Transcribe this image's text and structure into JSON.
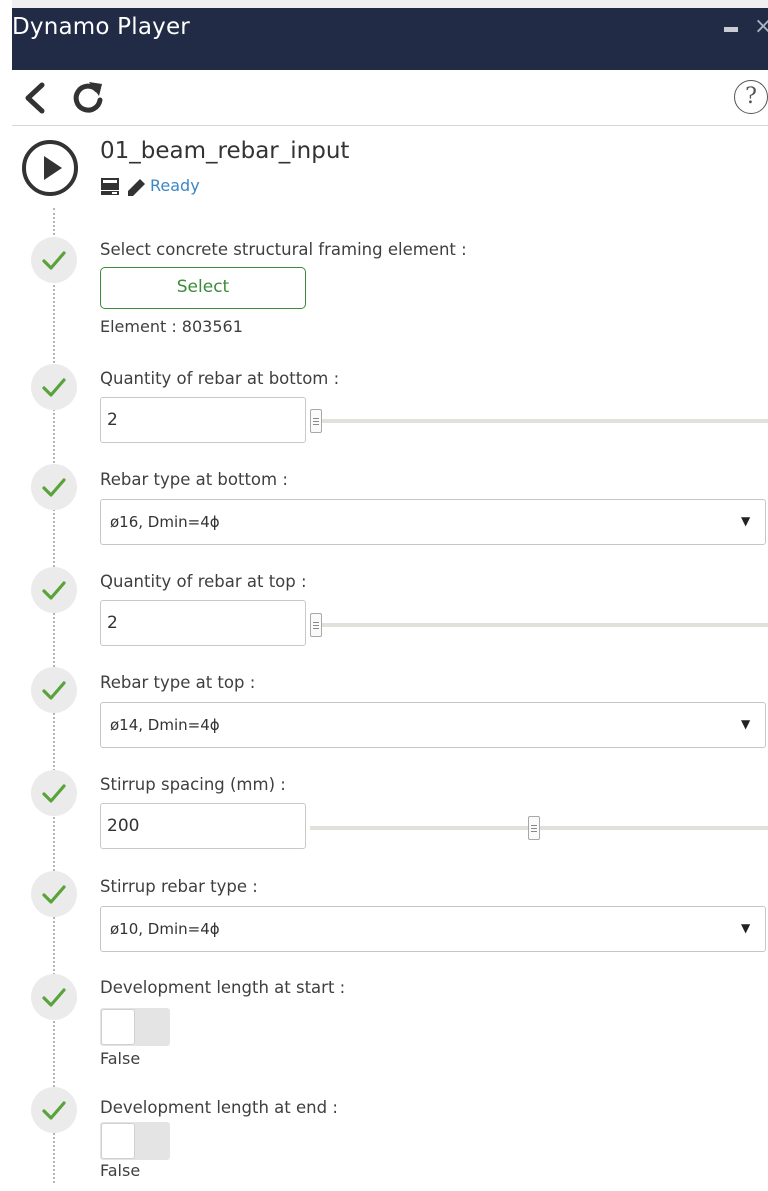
{
  "window": {
    "title": "Dynamo Player",
    "minimize_icon": "minimize-icon",
    "close_glyph": "×"
  },
  "toolbar": {
    "back_icon": "chevron-left-icon",
    "refresh_icon": "refresh-icon",
    "help_glyph": "?"
  },
  "script": {
    "name": "01_beam_rebar_input",
    "status": "Ready",
    "icons": [
      "play-icon",
      "computer-icon",
      "pencil-icon"
    ]
  },
  "colors": {
    "titlebar_bg": "#212b46",
    "check_green": "#59a33a",
    "select_green": "#3a8b3a",
    "status_blue": "#3d86c6"
  },
  "inputs": [
    {
      "label": "Select concrete structural framing element :",
      "type": "select",
      "button": "Select",
      "result": "Element : 803561"
    },
    {
      "label": "Quantity of rebar at bottom :",
      "type": "slider",
      "value": "2",
      "position": 0.0
    },
    {
      "label": "Rebar type at bottom :",
      "type": "dropdown",
      "value": "ø16, Dmin=4ϕ"
    },
    {
      "label": "Quantity of rebar at top :",
      "type": "slider",
      "value": "2",
      "position": 0.0
    },
    {
      "label": "Rebar type at top :",
      "type": "dropdown",
      "value": "ø14, Dmin=4ϕ"
    },
    {
      "label": "Stirrup spacing (mm) :",
      "type": "slider",
      "value": "200",
      "position": 0.5
    },
    {
      "label": "Stirrup rebar type :",
      "type": "dropdown",
      "value": "ø10, Dmin=4ϕ"
    },
    {
      "label": "Development length at start :",
      "type": "toggle",
      "value": "False"
    },
    {
      "label": "Development length at end :",
      "type": "toggle",
      "value": "False"
    }
  ]
}
